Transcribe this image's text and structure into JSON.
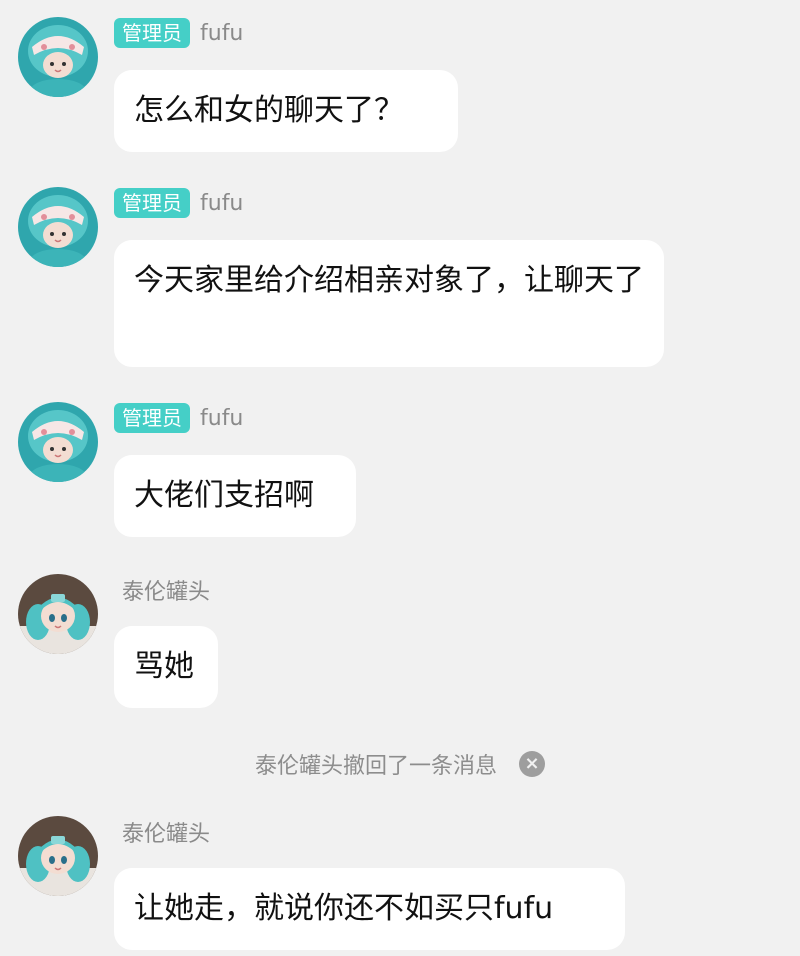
{
  "messages": [
    {
      "sender": "fufu",
      "role_badge": "管理员",
      "avatar": "hooded-plush-avatar",
      "text": "怎么和女的聊天了？"
    },
    {
      "sender": "fufu",
      "role_badge": "管理员",
      "avatar": "hooded-plush-avatar",
      "text": "今天家里给介绍相亲对象了，让聊天了"
    },
    {
      "sender": "fufu",
      "role_badge": "管理员",
      "avatar": "hooded-plush-avatar",
      "text": "大佬们支招啊"
    },
    {
      "sender": "泰伦罐头",
      "avatar": "miku-plush-avatar",
      "text": "骂她"
    },
    {
      "sender": "泰伦罐头",
      "avatar": "miku-plush-avatar",
      "text": "让她走，就说你还不如买只fufu"
    }
  ],
  "recall_notice": {
    "text": "泰伦罐头撤回了一条消息",
    "icon": "close-icon"
  },
  "colors": {
    "background": "#f1f1f1",
    "bubble": "#ffffff",
    "badge": "#45cfc7",
    "name": "#8a8a8a",
    "hood_teal": "#52c2c6",
    "skin": "#f3ddd2"
  }
}
